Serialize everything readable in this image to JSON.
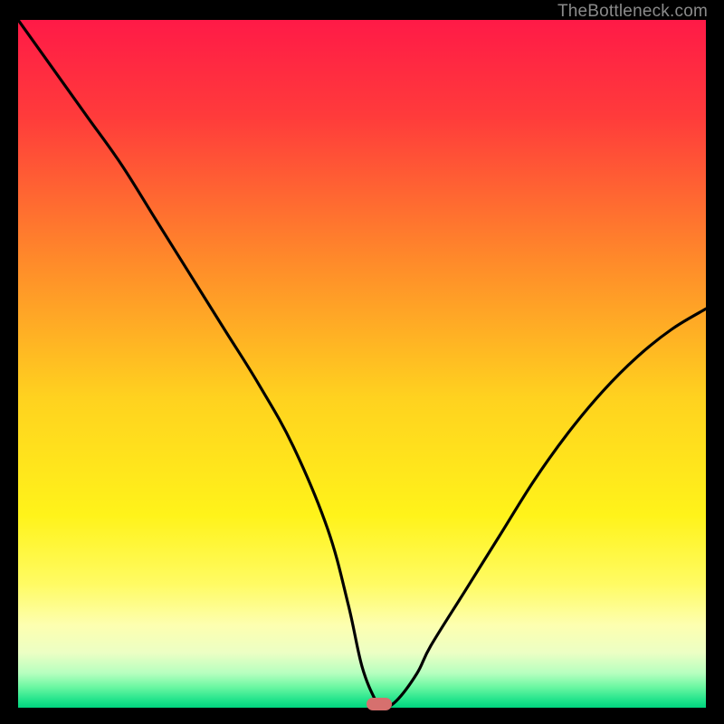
{
  "watermark": "TheBottleneck.com",
  "chart_data": {
    "type": "line",
    "title": "",
    "xlabel": "",
    "ylabel": "",
    "xlim": [
      0,
      100
    ],
    "ylim": [
      0,
      100
    ],
    "grid": false,
    "series": [
      {
        "name": "bottleneck-curve",
        "x": [
          0,
          5,
          10,
          15,
          20,
          25,
          30,
          35,
          40,
          45,
          48,
          50,
          52,
          53,
          55,
          58,
          60,
          65,
          70,
          75,
          80,
          85,
          90,
          95,
          100
        ],
        "y": [
          100,
          93,
          86,
          79,
          71,
          63,
          55,
          47,
          38,
          26,
          15,
          6,
          1,
          0,
          1,
          5,
          9,
          17,
          25,
          33,
          40,
          46,
          51,
          55,
          58
        ]
      }
    ],
    "marker": {
      "x": 52.5,
      "y": 0.5,
      "color": "#d6706e"
    },
    "gradient_stops": [
      {
        "pct": 0,
        "color": "#ff1a47"
      },
      {
        "pct": 14,
        "color": "#ff3b3b"
      },
      {
        "pct": 35,
        "color": "#ff8a2a"
      },
      {
        "pct": 55,
        "color": "#ffd21f"
      },
      {
        "pct": 72,
        "color": "#fff31a"
      },
      {
        "pct": 82,
        "color": "#fffb63"
      },
      {
        "pct": 88,
        "color": "#fdffb0"
      },
      {
        "pct": 92,
        "color": "#ecffc4"
      },
      {
        "pct": 95,
        "color": "#b6ffbf"
      },
      {
        "pct": 97,
        "color": "#6bf7a2"
      },
      {
        "pct": 99,
        "color": "#1de28a"
      },
      {
        "pct": 100,
        "color": "#00d47e"
      }
    ]
  }
}
